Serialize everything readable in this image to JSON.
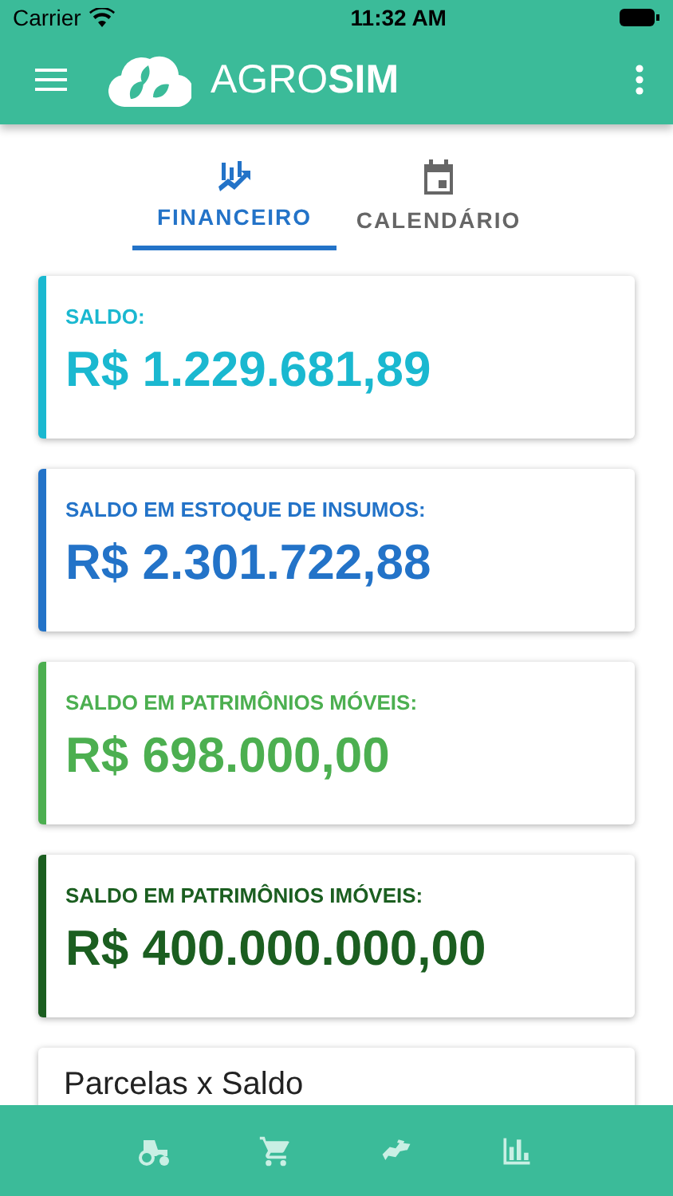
{
  "status_bar": {
    "carrier": "Carrier",
    "time": "11:32 AM"
  },
  "app_bar": {
    "title_light": "AGRO",
    "title_bold": "SIM"
  },
  "tabs": [
    {
      "label": "FINANCEIRO",
      "selected": true
    },
    {
      "label": "CALENDÁRIO",
      "selected": false
    }
  ],
  "cards": [
    {
      "label": "SALDO:",
      "value": "R$ 1.229.681,89",
      "color": "#1ab8d0"
    },
    {
      "label": "SALDO EM ESTOQUE DE INSUMOS:",
      "value": "R$ 2.301.722,88",
      "color": "#2373c8"
    },
    {
      "label": "SALDO EM PATRIMÔNIOS MÓVEIS:",
      "value": "R$ 698.000,00",
      "color": "#4caf50"
    },
    {
      "label": "SALDO EM PATRIMÔNIOS IMÓVEIS:",
      "value": "R$ 400.000.000,00",
      "color": "#1b5e20"
    }
  ],
  "chart_card": {
    "title": "Parcelas x Saldo"
  }
}
